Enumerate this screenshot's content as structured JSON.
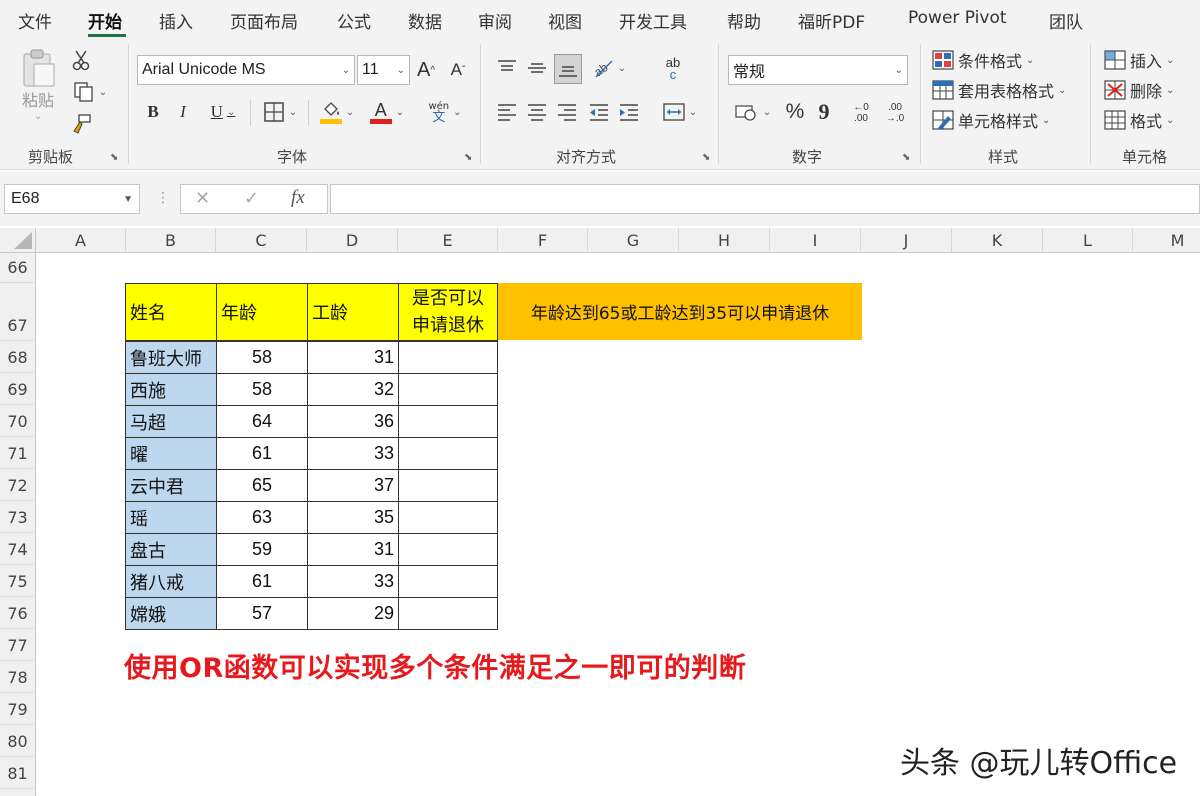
{
  "menu": {
    "tabs": [
      "文件",
      "开始",
      "插入",
      "页面布局",
      "公式",
      "数据",
      "审阅",
      "视图",
      "开发工具",
      "帮助",
      "福昕PDF",
      "Power Pivot",
      "团队"
    ],
    "active": "开始"
  },
  "ribbon": {
    "clipboard": {
      "label": "剪贴板",
      "paste": "粘贴"
    },
    "font": {
      "label": "字体",
      "name": "Arial Unicode MS",
      "size": "11",
      "grow": "A",
      "shrink": "A",
      "bold": "B",
      "italic": "I",
      "underline": "U",
      "phonetic_top": "wén",
      "phonetic_bottom": "文",
      "font_color_letter": "A",
      "fill_color": "#FFC000",
      "font_color": "#E02020"
    },
    "alignment": {
      "label": "对齐方式",
      "wrap_top": "ab",
      "wrap_bottom": "c"
    },
    "number": {
      "label": "数字",
      "format": "常规",
      "percent": "%",
      "comma": "9",
      "inc_decimal_top": "←0",
      "inc_decimal_bottom": ".00",
      "dec_decimal_top": ".00",
      "dec_decimal_bottom": "→.0"
    },
    "styles": {
      "label": "样式",
      "conditional": "条件格式",
      "table": "套用表格格式",
      "cell_styles": "单元格样式"
    },
    "cells": {
      "label": "单元格",
      "insert": "插入",
      "delete": "删除",
      "format": "格式"
    }
  },
  "formula_bar": {
    "name_box": "E68",
    "cancel": "✕",
    "enter": "✓",
    "fx": "fx",
    "formula": ""
  },
  "sheet": {
    "columns": [
      "A",
      "B",
      "C",
      "D",
      "E",
      "F",
      "G",
      "H",
      "I",
      "J",
      "K",
      "L",
      "M"
    ],
    "rows": [
      "66",
      "67",
      "68",
      "69",
      "70",
      "71",
      "72",
      "73",
      "74",
      "75",
      "76",
      "77",
      "78",
      "79",
      "80",
      "81"
    ],
    "table_headers": {
      "name": "姓名",
      "age": "年龄",
      "service": "工龄",
      "retire_line1": "是否可以",
      "retire_line2": "申请退休"
    },
    "records": [
      {
        "name": "鲁班大师",
        "age": "58",
        "service": "31",
        "retire": ""
      },
      {
        "name": "西施",
        "age": "58",
        "service": "32",
        "retire": ""
      },
      {
        "name": "马超",
        "age": "64",
        "service": "36",
        "retire": ""
      },
      {
        "name": "曜",
        "age": "61",
        "service": "33",
        "retire": ""
      },
      {
        "name": "云中君",
        "age": "65",
        "service": "37",
        "retire": ""
      },
      {
        "name": "瑶",
        "age": "63",
        "service": "35",
        "retire": ""
      },
      {
        "name": "盘古",
        "age": "59",
        "service": "31",
        "retire": ""
      },
      {
        "name": "猪八戒",
        "age": "61",
        "service": "33",
        "retire": ""
      },
      {
        "name": "嫦娥",
        "age": "57",
        "service": "29",
        "retire": ""
      }
    ],
    "note": "年龄达到65或工龄达到35可以申请退休",
    "note_color": "#FFC000",
    "caption": "使用OR函数可以实现多个条件满足之一即可的判断",
    "caption_color": "#E8191C",
    "header_fill": "#FFFF00",
    "name_fill": "#BDD7EE"
  },
  "watermark": "头条 @玩儿转Office"
}
